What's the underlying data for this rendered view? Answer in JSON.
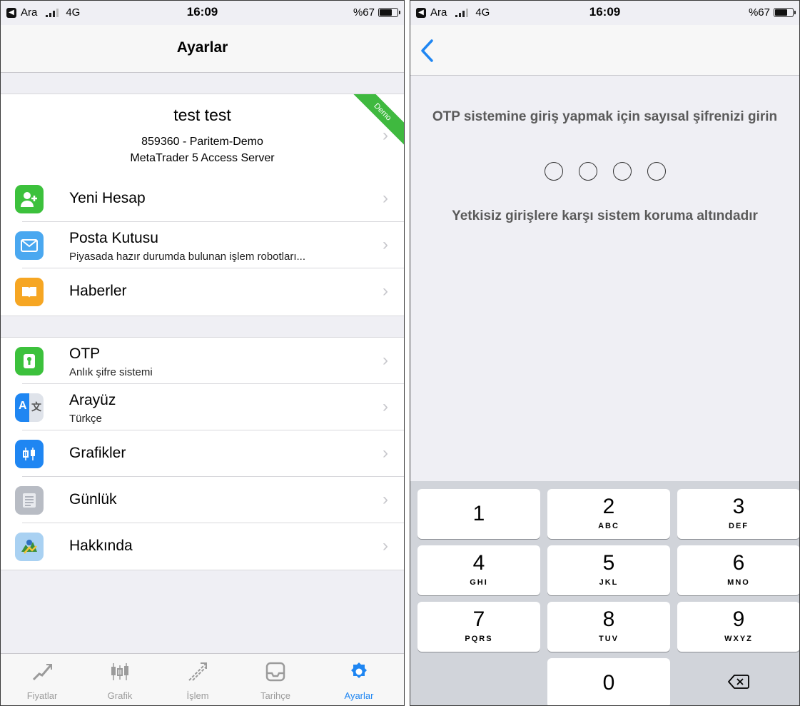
{
  "status_bar": {
    "back_app": "Ara",
    "network": "4G",
    "time": "16:09",
    "battery": "%67",
    "battery_level": 0.67,
    "back_badge_symbol": "◀"
  },
  "settings": {
    "title": "Ayarlar",
    "account": {
      "name": "test test",
      "line1": "859360 - Paritem-Demo",
      "line2": "MetaTrader 5 Access Server",
      "badge": "Demo"
    },
    "group1": [
      {
        "label": "Yeni Hesap",
        "subtitle": "",
        "icon": "add-person-icon",
        "color": "#3cc13c"
      },
      {
        "label": "Posta Kutusu",
        "subtitle": "Piyasada hazır durumda bulunan işlem robotları...",
        "icon": "mail-icon",
        "color": "#4aa8f0"
      },
      {
        "label": "Haberler",
        "subtitle": "",
        "icon": "book-icon",
        "color": "#f6a623"
      }
    ],
    "group2": [
      {
        "label": "OTP",
        "subtitle": "Anlık şifre sistemi",
        "icon": "keyhole-icon",
        "color": "#3cc13c"
      },
      {
        "label": "Arayüz",
        "subtitle": "Türkçe",
        "icon": "language-icon",
        "color": "#1f86f2"
      },
      {
        "label": "Grafikler",
        "subtitle": "",
        "icon": "candlestick-icon",
        "color": "#1f86f2"
      },
      {
        "label": "Günlük",
        "subtitle": "",
        "icon": "journal-icon",
        "color": "#b8bcc4"
      },
      {
        "label": "Hakkında",
        "subtitle": "",
        "icon": "metatrader-icon",
        "color": "#7fb7e6"
      }
    ],
    "chevron": "›"
  },
  "tabbar": [
    {
      "label": "Fiyatlar",
      "icon": "quotes-icon",
      "active": false
    },
    {
      "label": "Grafik",
      "icon": "chart-icon",
      "active": false
    },
    {
      "label": "İşlem",
      "icon": "trade-icon",
      "active": false
    },
    {
      "label": "Tarihçe",
      "icon": "history-icon",
      "active": false
    },
    {
      "label": "Ayarlar",
      "icon": "gear-icon",
      "active": true
    }
  ],
  "otp": {
    "prompt": "OTP sistemine giriş yapmak için sayısal şifrenizi girin",
    "protected_note": "Yetkisiz girişlere karşı sistem koruma altındadır",
    "digits_entered": 0,
    "digit_slots": 4
  },
  "keypad": [
    {
      "num": "1",
      "letters": ""
    },
    {
      "num": "2",
      "letters": "ABC"
    },
    {
      "num": "3",
      "letters": "DEF"
    },
    {
      "num": "4",
      "letters": "GHI"
    },
    {
      "num": "5",
      "letters": "JKL"
    },
    {
      "num": "6",
      "letters": "MNO"
    },
    {
      "num": "7",
      "letters": "PQRS"
    },
    {
      "num": "8",
      "letters": "TUV"
    },
    {
      "num": "9",
      "letters": "WXYZ"
    },
    {
      "num": "0",
      "letters": ""
    }
  ],
  "colors": {
    "accent": "#1f86f2",
    "demo_badge": "#3fb93f",
    "inactive_tab": "#9b9b9b"
  }
}
